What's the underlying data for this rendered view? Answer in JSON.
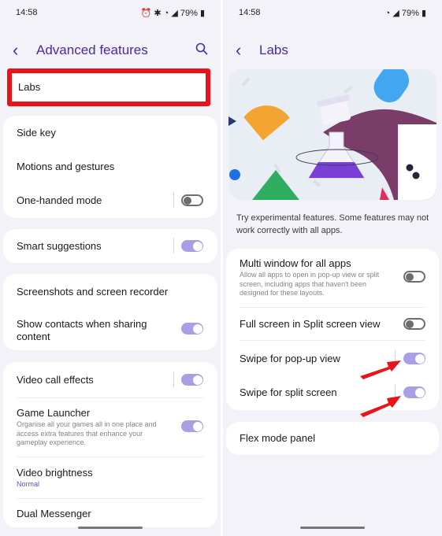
{
  "colors": {
    "accent": "#4b2a9a",
    "toggle_on": "#a89fe4",
    "highlight": "#e9141b",
    "arrow": "#e8141b"
  },
  "status": {
    "time": "14:58",
    "battery": "79%"
  },
  "left": {
    "header": {
      "title": "Advanced features"
    },
    "labs": {
      "label": "Labs"
    },
    "side_key": {
      "label": "Side key"
    },
    "motions": {
      "label": "Motions and gestures"
    },
    "one_handed": {
      "label": "One-handed mode",
      "state": "off"
    },
    "smart": {
      "label": "Smart suggestions",
      "state": "on"
    },
    "screenshots": {
      "label": "Screenshots and screen recorder"
    },
    "contacts": {
      "label": "Show contacts when sharing content",
      "state": "on"
    },
    "video_call": {
      "label": "Video call effects",
      "state": "on"
    },
    "game_launcher": {
      "label": "Game Launcher",
      "sub": "Organise all your games all in one place and access extra features that enhance your gameplay experience.",
      "state": "on"
    },
    "video_brightness": {
      "label": "Video brightness",
      "value": "Normal"
    },
    "dual_messenger": {
      "label": "Dual Messenger"
    }
  },
  "right": {
    "header": {
      "title": "Labs"
    },
    "description": "Try experimental features. Some features may not work correctly with all apps.",
    "multi_window": {
      "label": "Multi window for all apps",
      "sub": "Allow all apps to open in pop-up view or split screen, including apps that haven't been designed for these layouts.",
      "state": "off"
    },
    "full_screen": {
      "label": "Full screen in Split screen view",
      "state": "off"
    },
    "swipe_popup": {
      "label": "Swipe for pop-up view",
      "state": "on"
    },
    "swipe_split": {
      "label": "Swipe for split screen",
      "state": "on"
    },
    "flex_mode": {
      "label": "Flex mode panel"
    }
  }
}
